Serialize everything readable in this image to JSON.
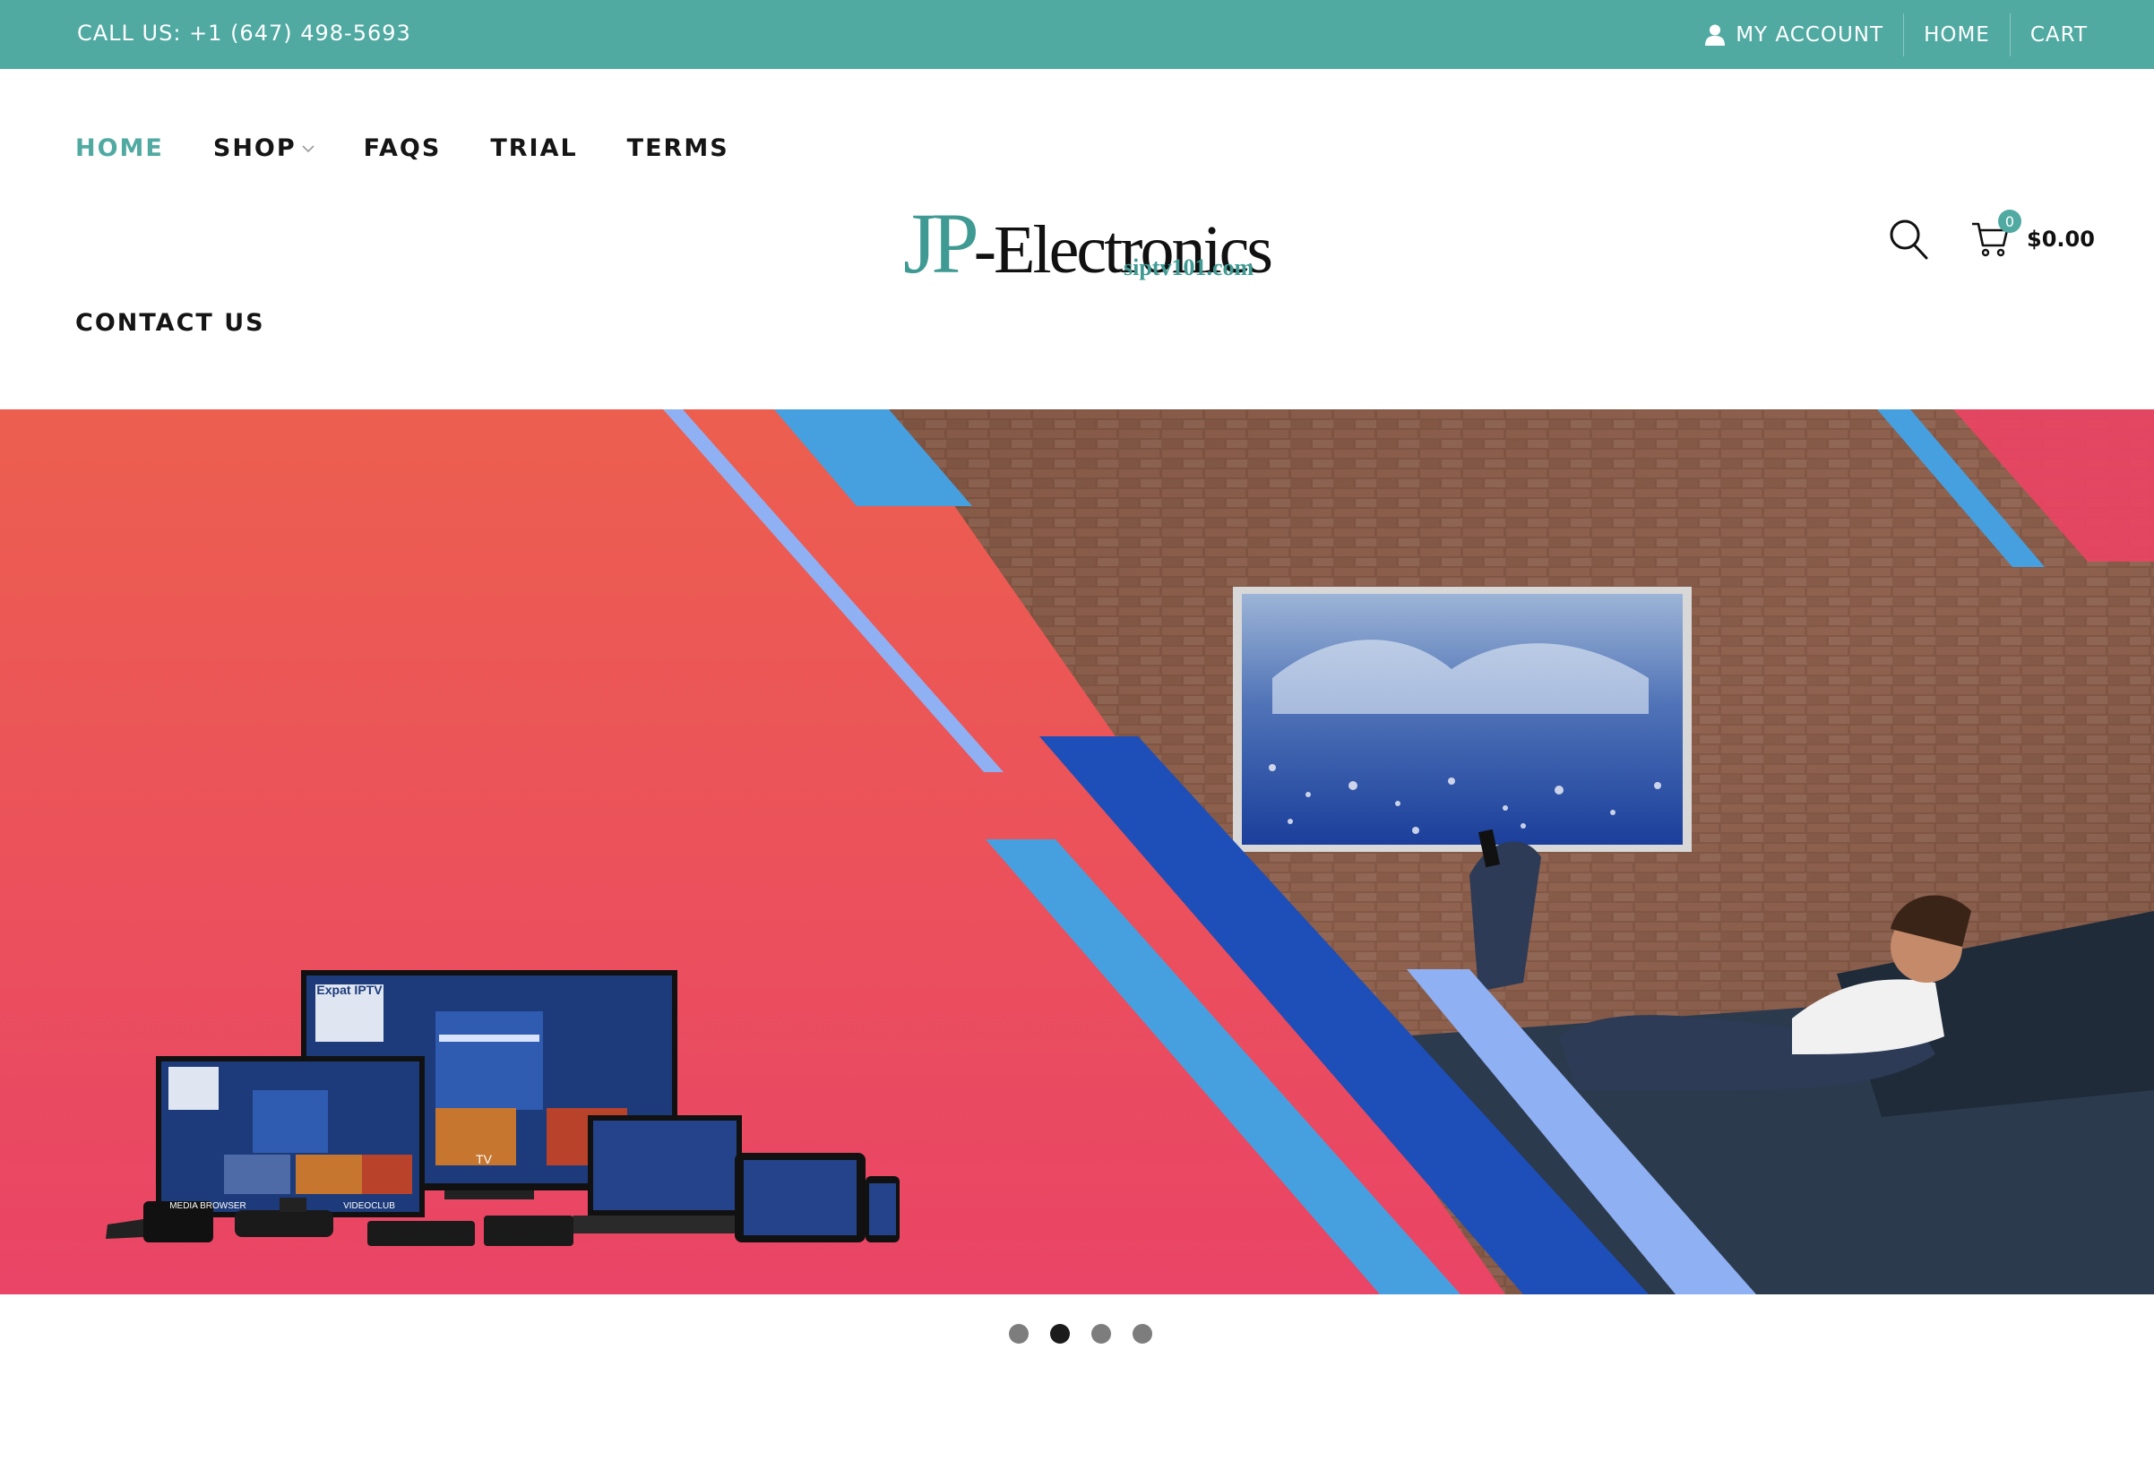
{
  "topbar": {
    "call_text": "CALL US: +1 (647) 498-5693",
    "my_account": "MY ACCOUNT",
    "home": "HOME",
    "cart": "CART",
    "bg_color": "#50aaa2"
  },
  "nav": {
    "items": [
      {
        "label": "HOME",
        "active": true
      },
      {
        "label": "SHOP",
        "has_dropdown": true
      },
      {
        "label": "FAQS"
      },
      {
        "label": "TRIAL"
      },
      {
        "label": "TERMS"
      }
    ],
    "contact": "CONTACT US",
    "accent_color": "#50aaa2"
  },
  "logo": {
    "jp": "JP",
    "brand": "-Electronics",
    "sub": "siptv101.com"
  },
  "header_icons": {
    "search": "search-icon",
    "cart": "cart-icon",
    "cart_count": "0",
    "cart_total": "$0.00"
  },
  "slider": {
    "slide_count": 4,
    "active_index": 1,
    "device_labels": [
      "TV",
      "VIDEOCLUB",
      "MEDIA BROWSER"
    ],
    "device_brand": "Expat IPTV"
  }
}
